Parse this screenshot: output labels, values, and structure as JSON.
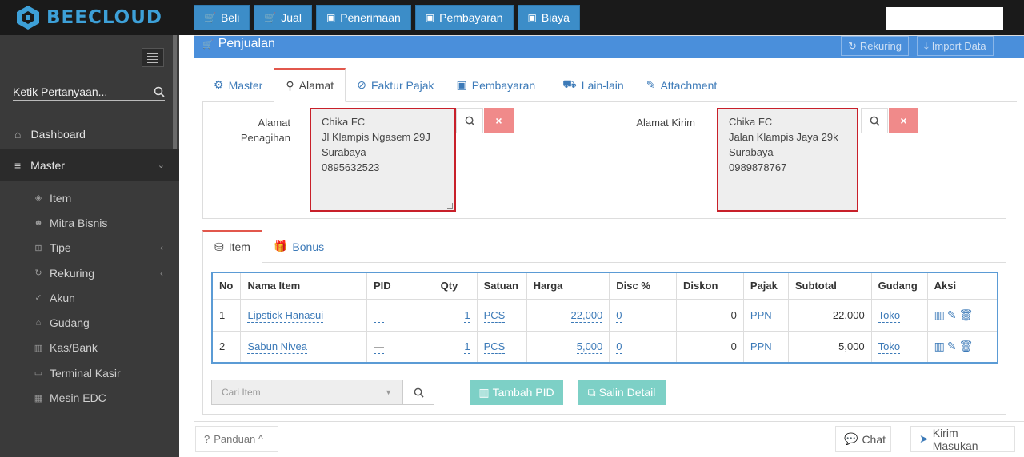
{
  "brand": {
    "name": "BEECLOUD"
  },
  "topnav": [
    {
      "label": "Beli",
      "icon": "cart-icon"
    },
    {
      "label": "Jual",
      "icon": "cart-icon"
    },
    {
      "label": "Penerimaan",
      "icon": "money-icon"
    },
    {
      "label": "Pembayaran",
      "icon": "money-icon"
    },
    {
      "label": "Biaya",
      "icon": "money-icon"
    }
  ],
  "sidebar": {
    "search_placeholder": "Ketik Pertanyaan...",
    "items": [
      {
        "label": "Dashboard"
      },
      {
        "label": "Master"
      }
    ],
    "sub": [
      {
        "label": "Item"
      },
      {
        "label": "Mitra Bisnis"
      },
      {
        "label": "Tipe"
      },
      {
        "label": "Rekuring"
      },
      {
        "label": "Akun"
      },
      {
        "label": "Gudang"
      },
      {
        "label": "Kas/Bank"
      },
      {
        "label": "Terminal Kasir"
      },
      {
        "label": "Mesin EDC"
      }
    ]
  },
  "panel": {
    "title": "Penjualan",
    "rekuring": "Rekuring",
    "import": "Import Data",
    "tabs": [
      "Master",
      "Alamat",
      "Faktur Pajak",
      "Pembayaran",
      "Lain-lain",
      "Attachment"
    ]
  },
  "alamat": {
    "penagihan_label_1": "Alamat",
    "penagihan_label_2": "Penagihan",
    "penagihan_lines": [
      "Chika FC",
      "Jl Klampis Ngasem 29J",
      "Surabaya",
      "0895632523"
    ],
    "kirim_label": "Alamat Kirim",
    "kirim_lines": [
      "Chika FC",
      "Jalan Klampis Jaya 29k",
      "Surabaya",
      "0989878767"
    ],
    "clear": "×"
  },
  "items": {
    "tabs": [
      "Item",
      "Bonus"
    ],
    "headers": [
      "No",
      "Nama Item",
      "PID",
      "Qty",
      "Satuan",
      "Harga",
      "Disc %",
      "Diskon",
      "Pajak",
      "Subtotal",
      "Gudang",
      "Aksi"
    ],
    "rows": [
      {
        "no": "1",
        "nama": "Lipstick Hanasui",
        "pid": "—",
        "qty": "1",
        "satuan": "PCS",
        "harga": "22,000",
        "disc": "0",
        "diskon": "0",
        "pajak": "PPN",
        "subtotal": "22,000",
        "gudang": "Toko"
      },
      {
        "no": "2",
        "nama": "Sabun Nivea",
        "pid": "—",
        "qty": "1",
        "satuan": "PCS",
        "harga": "5,000",
        "disc": "0",
        "diskon": "0",
        "pajak": "PPN",
        "subtotal": "5,000",
        "gudang": "Toko"
      }
    ],
    "cari_placeholder": "Cari Item",
    "tambah_pid": "Tambah PID",
    "salin_detail": "Salin Detail"
  },
  "footer": {
    "panduan": "Panduan ^",
    "chat": "Chat",
    "kirim": "Kirim Masukan"
  },
  "colors": {
    "accent": "#4a8fdb",
    "danger": "#c8202a",
    "teal": "#7dd0c6"
  }
}
